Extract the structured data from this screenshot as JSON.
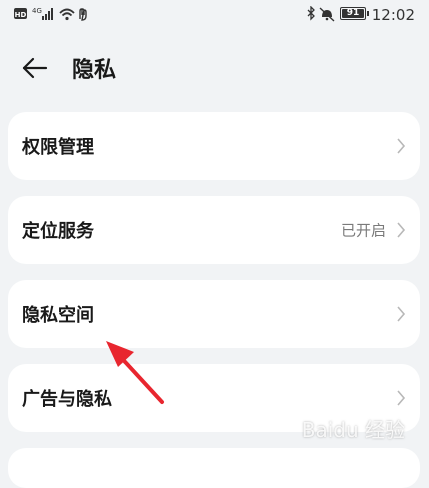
{
  "status_bar": {
    "left_badge": "HD",
    "signal_label": "4G",
    "battery_level": "91",
    "time": "12:02"
  },
  "header": {
    "title": "隐私"
  },
  "items": [
    {
      "label": "权限管理",
      "value": ""
    },
    {
      "label": "定位服务",
      "value": "已开启"
    },
    {
      "label": "隐私空间",
      "value": ""
    },
    {
      "label": "广告与隐私",
      "value": ""
    }
  ],
  "watermark": "Baidu 经验",
  "colors": {
    "background": "#f1f3f5",
    "card": "#ffffff",
    "annotation_arrow": "#e8262f",
    "secondary_text": "#7a7a7a"
  }
}
